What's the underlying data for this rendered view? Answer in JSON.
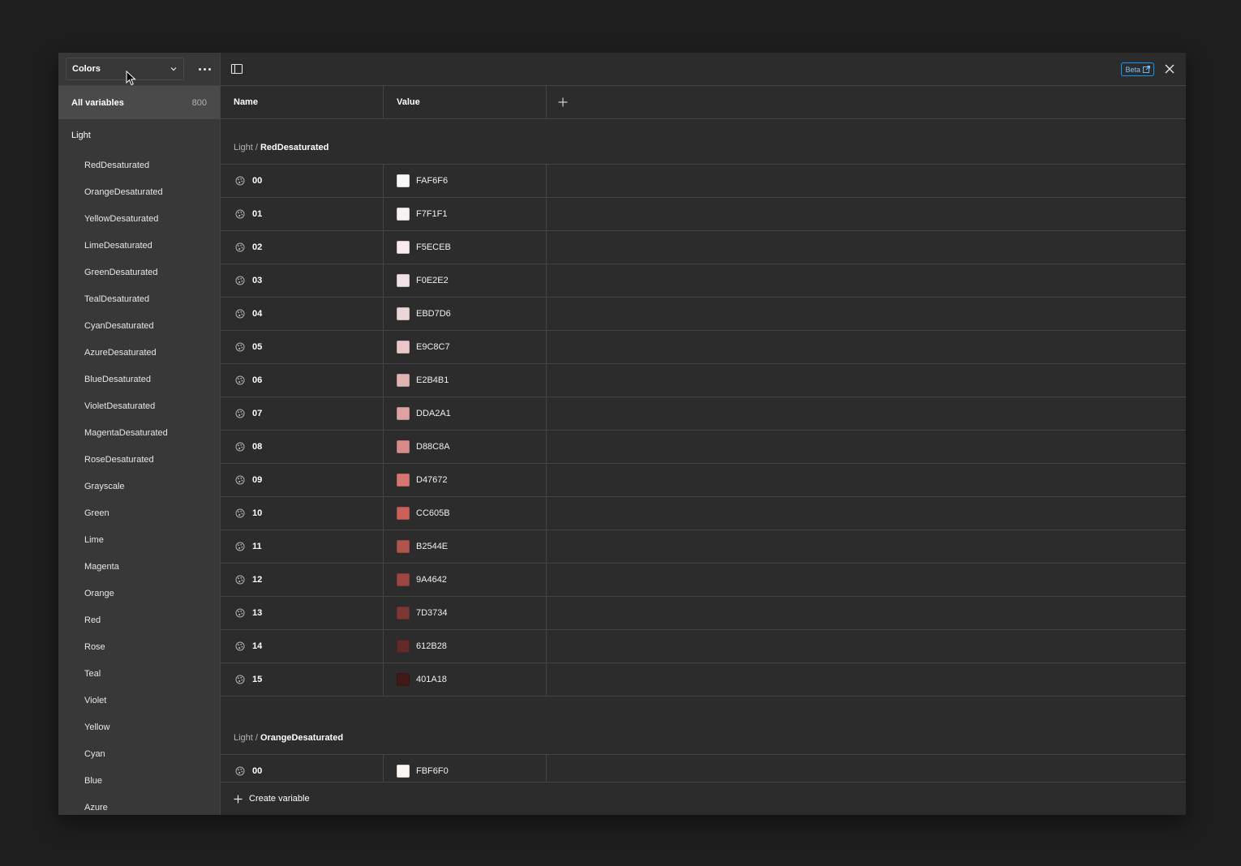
{
  "sidebar": {
    "collection": "Colors",
    "all_variables": {
      "label": "All variables",
      "count": "800"
    },
    "group": "Light",
    "items": [
      "RedDesaturated",
      "OrangeDesaturated",
      "YellowDesaturated",
      "LimeDesaturated",
      "GreenDesaturated",
      "TealDesaturated",
      "CyanDesaturated",
      "AzureDesaturated",
      "BlueDesaturated",
      "VioletDesaturated",
      "MagentaDesaturated",
      "RoseDesaturated",
      "Grayscale",
      "Green",
      "Lime",
      "Magenta",
      "Orange",
      "Red",
      "Rose",
      "Teal",
      "Violet",
      "Yellow",
      "Cyan",
      "Blue",
      "Azure"
    ]
  },
  "header": {
    "beta": "Beta"
  },
  "table": {
    "columns": {
      "name": "Name",
      "value": "Value"
    },
    "groups": [
      {
        "prefix": "Light /",
        "name": "RedDesaturated",
        "rows": [
          {
            "name": "00",
            "hex": "FAF6F6",
            "color": "#FAF6F6"
          },
          {
            "name": "01",
            "hex": "F7F1F1",
            "color": "#F7F1F1"
          },
          {
            "name": "02",
            "hex": "F5ECEB",
            "color": "#F5ECEB"
          },
          {
            "name": "03",
            "hex": "F0E2E2",
            "color": "#F0E2E2"
          },
          {
            "name": "04",
            "hex": "EBD7D6",
            "color": "#EBD7D6"
          },
          {
            "name": "05",
            "hex": "E9C8C7",
            "color": "#E9C8C7"
          },
          {
            "name": "06",
            "hex": "E2B4B1",
            "color": "#E2B4B1"
          },
          {
            "name": "07",
            "hex": "DDA2A1",
            "color": "#DDA2A1"
          },
          {
            "name": "08",
            "hex": "D88C8A",
            "color": "#D88C8A"
          },
          {
            "name": "09",
            "hex": "D47672",
            "color": "#D47672"
          },
          {
            "name": "10",
            "hex": "CC605B",
            "color": "#CC605B"
          },
          {
            "name": "11",
            "hex": "B2544E",
            "color": "#B2544E"
          },
          {
            "name": "12",
            "hex": "9A4642",
            "color": "#9A4642"
          },
          {
            "name": "13",
            "hex": "7D3734",
            "color": "#7D3734"
          },
          {
            "name": "14",
            "hex": "612B28",
            "color": "#612B28"
          },
          {
            "name": "15",
            "hex": "401A18",
            "color": "#401A18"
          }
        ]
      },
      {
        "prefix": "Light /",
        "name": "OrangeDesaturated",
        "rows": [
          {
            "name": "00",
            "hex": "FBF6F0",
            "color": "#FBF6F0"
          }
        ]
      }
    ]
  },
  "footer": {
    "create_label": "Create variable"
  }
}
